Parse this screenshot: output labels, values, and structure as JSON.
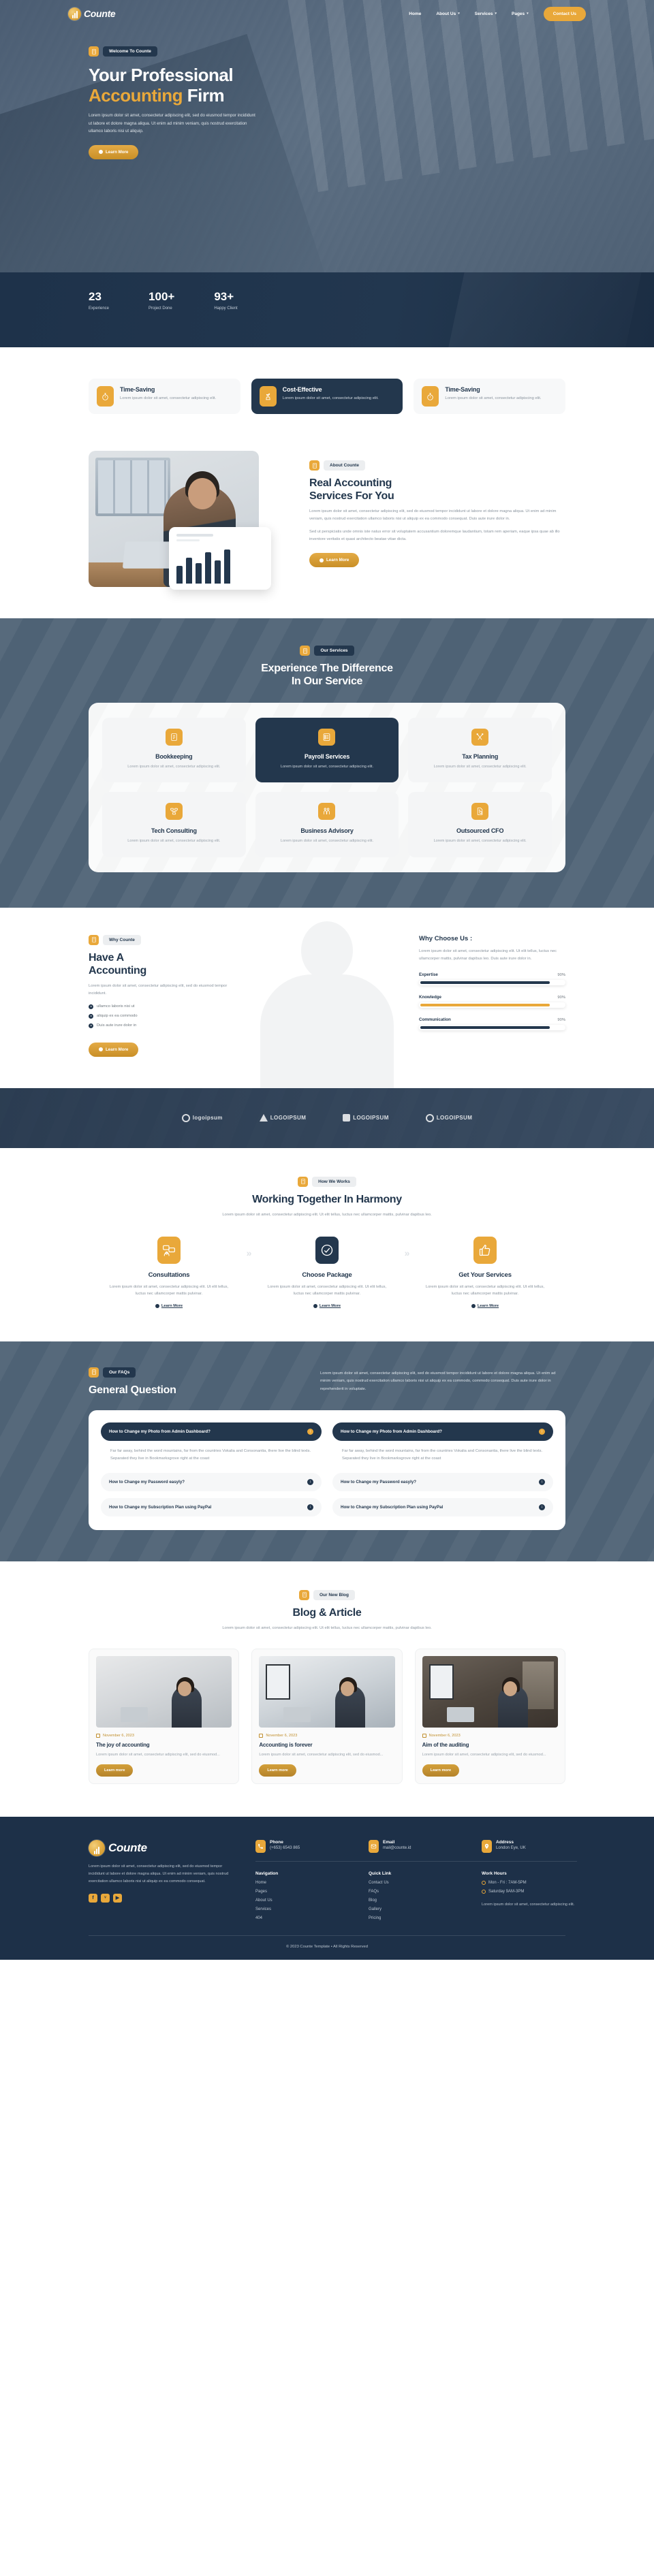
{
  "nav": {
    "brand": "Counte",
    "links": [
      {
        "label": "Home",
        "caret": false
      },
      {
        "label": "About Us",
        "caret": true
      },
      {
        "label": "Services",
        "caret": true
      },
      {
        "label": "Pages",
        "caret": true
      }
    ],
    "cta": "Contact Us",
    "caret_glyph": "▾"
  },
  "hero": {
    "badge": "Welcome To Counte",
    "title_line1": "Your Professional",
    "title_line2": "Accounting",
    "title_line3": "Firm",
    "paragraph": "Lorem ipsum dolor sit amet, consectetur adipiscing elit, sed do eiusmod tempor incididunt ut labore et dolore magna aliqua. Ut enim ad minim veniam, quis nostrud exercitation ullamco laboris nisi ut aliquip.",
    "cta": "Learn More"
  },
  "stats": [
    {
      "value": "23",
      "label": "Experience"
    },
    {
      "value": "100+",
      "label": "Project Done"
    },
    {
      "value": "93+",
      "label": "Happy Client"
    }
  ],
  "features": [
    {
      "title": "Time-Saving",
      "text": "Lorem ipsum dolor sit amet, consectetur adipiscing elit.",
      "icon": "stopwatch-icon",
      "active": false
    },
    {
      "title": "Cost-Effective",
      "text": "Lorem ipsum dolor sit amet, consectetur adipiscing elit.",
      "icon": "money-plant-icon",
      "active": true
    },
    {
      "title": "Time-Saving",
      "text": "Lorem ipsum dolor sit amet, consectetur adipiscing elit.",
      "icon": "stopwatch-icon",
      "active": false
    }
  ],
  "about": {
    "badge": "About Counte",
    "title_l1": "Real Accounting",
    "title_l2": "Services For You",
    "p1": "Lorem ipsum dolor sit amet, consectetur adipiscing elit, sed do eiusmod tempor incididunt ut labore et dolore magna aliqua. Ut enim ad minim veniam, quis nostrud exercitation ullamco laboris nisi ut aliquip ex ea commodo consequat. Duis aute irure dolor in.",
    "p2": "Sed ut perspiciatis unde omnis iste natus error sit voluptatem accusantium doloremque laudantium, totam rem aperiam, eaque ipsa quae ab illo inventore veritatis et quasi architecto beatae vitae dicta.",
    "cta": "Learn More",
    "chart_bar_heights": [
      26,
      38,
      30,
      46,
      34,
      50
    ]
  },
  "services": {
    "badge": "Our Services",
    "title_l1": "Experience The Difference",
    "title_l2": "In Our Service",
    "cards": [
      {
        "title": "Bookkeeping",
        "text": "Lorem ipsum dolor sit amet, consectetur adipiscing elit.",
        "icon": "ledger-book-icon",
        "active": false
      },
      {
        "title": "Payroll Services",
        "text": "Lorem ipsum dolor sit amet, consectetur adipiscing elit.",
        "icon": "checklist-icon",
        "active": true
      },
      {
        "title": "Tax Planning",
        "text": "Lorem ipsum dolor sit amet, consectetur adipiscing elit.",
        "icon": "tools-cross-icon",
        "active": false
      },
      {
        "title": "Tech Consulting",
        "text": "Lorem ipsum dolor sit amet, consectetur adipiscing elit.",
        "icon": "network-icon",
        "active": false
      },
      {
        "title": "Business Advisory",
        "text": "Lorem ipsum dolor sit amet, consectetur adipiscing elit.",
        "icon": "people-icon",
        "active": false
      },
      {
        "title": "Outsourced CFO",
        "text": "Lorem ipsum dolor sit amet, consectetur adipiscing elit.",
        "icon": "document-search-icon",
        "active": false
      }
    ]
  },
  "why": {
    "badge": "Why Counte",
    "title_l1": "Have A",
    "title_l2": "Accounting",
    "paragraph": "Lorem ipsum dolor sit amet, consectetur adipiscing elit, sed do eiusmod tempor incididunt.",
    "bullets": [
      "ullamco laboris nisi ut",
      "aliquip ex ea commodo",
      "Duis aute irure dolor in"
    ],
    "cta": "Learn More",
    "right_title": "Why Choose Us :",
    "right_paragraph": "Lorem ipsum dolor sit amet, consectetur adipiscing elit. Ut elit tellus, luctus nec ullamcorper mattis, pulvinar dapibus leo. Duis aute irure dolor in.",
    "bars": [
      {
        "label": "Expertise",
        "value": "90%",
        "pct": 90,
        "gold": false
      },
      {
        "label": "Knowledge",
        "value": "90%",
        "pct": 90,
        "gold": true
      },
      {
        "label": "Communication",
        "value": "90%",
        "pct": 90,
        "gold": false
      }
    ]
  },
  "logos": [
    {
      "text": "logoipsum",
      "shape": "circle"
    },
    {
      "text": "LOGOIPSUM",
      "shape": "triangle"
    },
    {
      "text": "LOGOIPSUM",
      "shape": "square"
    },
    {
      "text": "LOGOIPSUM",
      "shape": "circle"
    }
  ],
  "howwork": {
    "badge": "How We Works",
    "title": "Working Together In Harmony",
    "paragraph": "Lorem ipsum dolor sit amet, consectetur adipiscing elit. Ut elit tellus, luctus nec ullamcorper mattis, pulvinar dapibus leo.",
    "steps": [
      {
        "title": "Consultations",
        "text": "Lorem ipsum dolor sit amet, consectetur adipiscing elit. Ut elit tellus, luctus nec ullamcorper mattis pulvinar.",
        "link": "Learn More",
        "icon": "consultation-icon",
        "active": false
      },
      {
        "title": "Choose Package",
        "text": "Lorem ipsum dolor sit amet, consectetur adipiscing elit. Ut elit tellus, luctus nec ullamcorper mattis pulvinar.",
        "link": "Learn More",
        "icon": "check-circle-icon",
        "active": true
      },
      {
        "title": "Get Your Services",
        "text": "Lorem ipsum dolor sit amet, consectetur adipiscing elit. Ut elit tellus, luctus nec ullamcorper mattis pulvinar.",
        "link": "Learn More",
        "icon": "thumbs-up-icon",
        "active": false
      }
    ],
    "arrow_glyph": "»"
  },
  "faq": {
    "badge": "Our FAQs",
    "title": "General Question",
    "paragraph": "Lorem ipsum dolor sit amet, consectetur adipiscing elit, sed do eiusmod tempor incididunt ut labore et dolore magna aliqua. Ut enim ad minim veniam, quis nostrud exercitation ullamco laboris nisi ut aliquip ex ea commodo, commodo consequat. Duis aute irure dolor in reprehenderit in voluptate.",
    "open_question": "How to Change my Photo from Admin Dashboard?",
    "open_answer": "Far far away, behind the word mountains, far from the countries Vokalia and Consonantia, there live the blind texts. Separated they live in Bookmarksgrove right at the coast",
    "closed_questions": [
      "How to Change my Password easyly?",
      "How to Change my Subscription Plan using PayPal"
    ],
    "open_icon": "↑",
    "closed_icon": "↓"
  },
  "blog": {
    "badge": "Our New Blog",
    "title": "Blog & Article",
    "paragraph": "Lorem ipsum dolor sit amet, consectetur adipiscing elit. Ut elit tellus, luctus nec ullamcorper mattis, pulvinar dapibus leo.",
    "posts": [
      {
        "date": "November 6, 2023",
        "title": "The joy of accounting",
        "text": "Lorem ipsum dolor sit amet, consectetur adipiscing elit, sed do eiusmod...",
        "cta": "Learn more"
      },
      {
        "date": "November 6, 2023",
        "title": "Accounting is forever",
        "text": "Lorem ipsum dolor sit amet, consectetur adipiscing elit, sed do eiusmod...",
        "cta": "Learn more"
      },
      {
        "date": "November 6, 2023",
        "title": "Aim of the auditing",
        "text": "Lorem ipsum dolor sit amet, consectetur adipiscing elit, sed do eiusmod...",
        "cta": "Learn more"
      }
    ]
  },
  "footer": {
    "brand": "Counte",
    "paragraph": "Lorem ipsum dolor sit amet, consectetur adipiscing elit, sed do eiusmod tempor incididunt ut labore et dolore magna aliqua. Ut enim ad minim veniam, quis nostrud exercitation ullamco laboris nisi ut aliquip ex ea commodo consequat.",
    "social": [
      {
        "name": "facebook-icon",
        "glyph": "f"
      },
      {
        "name": "twitter-icon",
        "glyph": "ᵛ"
      },
      {
        "name": "youtube-icon",
        "glyph": "▶"
      }
    ],
    "contacts": [
      {
        "title": "Phone",
        "value": "(+653) 6543 865",
        "icon": "phone-icon"
      },
      {
        "title": "Email",
        "value": "mail@counte.id",
        "icon": "email-icon"
      },
      {
        "title": "Address",
        "value": "London Eye, UK",
        "icon": "map-pin-icon"
      }
    ],
    "nav_heading": "Navigation",
    "nav_links": [
      "Home",
      "Pages",
      "About Us",
      "Services",
      "404"
    ],
    "quick_heading": "Quick Link",
    "quick_links": [
      "Contact Us",
      "FAQs",
      "Blog",
      "Gallery",
      "Pricing"
    ],
    "hours_heading": "Work Hours",
    "hours": [
      "Mon - Fri : 7AM-5PM",
      "Saturday 9AM-3PM"
    ],
    "hours_note": "Lorem ipsum dolor sit amet, consectetur adipiscing elit.",
    "copyright": "© 2023 Counte Template • All Rights Reserved"
  },
  "colors": {
    "accent": "#e9a83a",
    "dark": "#23374d",
    "slate": "#4e6275",
    "footer": "#1d3048"
  }
}
